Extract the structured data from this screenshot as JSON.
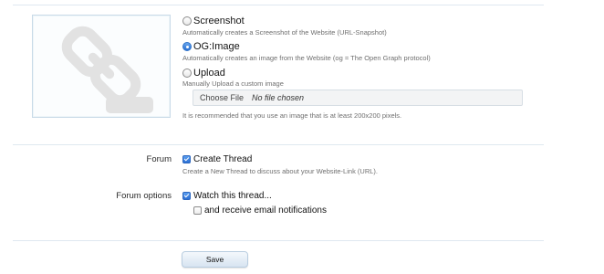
{
  "image_source": {
    "options": [
      {
        "label": "Screenshot",
        "hint": "Automatically creates a Screenshot of the Website (URL-Snapshot)",
        "selected": false
      },
      {
        "label": "OG:Image",
        "hint": "Automatically creates an image from the Website (og = The Open Graph protocol)",
        "selected": true
      },
      {
        "label": "Upload",
        "hint": "Manually Upload a custom image",
        "selected": false
      }
    ],
    "file_button": "Choose File",
    "file_status": "No file chosen",
    "recommendation": "It is recommended that you use an image that is at least 200x200 pixels.",
    "preview_icon": "link-icon"
  },
  "forum": {
    "label": "Forum",
    "create_thread": {
      "label": "Create Thread",
      "checked": true
    },
    "hint": "Create a New Thread to discuss about your Website-Link (URL)."
  },
  "forum_options": {
    "label": "Forum options",
    "watch_thread": {
      "label": "Watch this thread...",
      "checked": true
    },
    "email_notifications": {
      "label": "and receive email notifications",
      "checked": false
    }
  },
  "actions": {
    "save_label": "Save"
  },
  "colors": {
    "accent": "#2b6fd4",
    "divider": "#dfe8f0",
    "hint_text": "#6f6f6f"
  }
}
